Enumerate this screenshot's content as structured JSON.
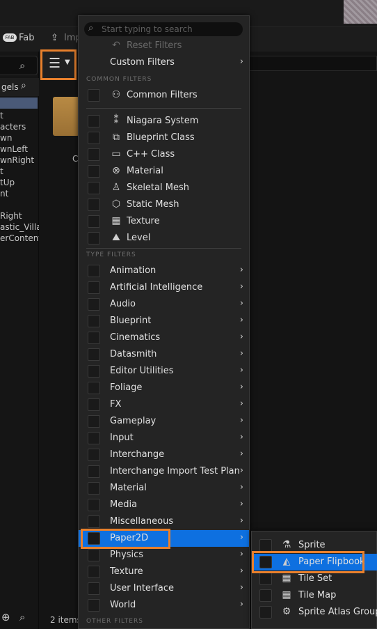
{
  "top_toolbar": {
    "fab_label": "Fab",
    "import_label": "Imp"
  },
  "left_panel": {
    "header_label": "gels",
    "tree_items": [
      "t",
      "acters",
      "wn",
      "wnLeft",
      "wnRight",
      "t",
      "tUp",
      "nt",
      "",
      "Right",
      "astic_Villa",
      "erContent"
    ]
  },
  "content": {
    "folder_caption": "C",
    "items_count": "2 items"
  },
  "filter_menu": {
    "search_placeholder": "Start typing to search",
    "reset_filters": "Reset Filters",
    "custom_filters": "Custom Filters",
    "common_filters_section": "COMMON FILTERS",
    "common_filters_item": "Common Filters",
    "common_items": [
      {
        "label": "Niagara System",
        "icon": "niagara-icon"
      },
      {
        "label": "Blueprint Class",
        "icon": "blueprint-class-icon"
      },
      {
        "label": "C++ Class",
        "icon": "cpp-class-icon"
      },
      {
        "label": "Material",
        "icon": "material-icon"
      },
      {
        "label": "Skeletal Mesh",
        "icon": "skeletal-mesh-icon"
      },
      {
        "label": "Static Mesh",
        "icon": "static-mesh-icon"
      },
      {
        "label": "Texture",
        "icon": "texture-icon"
      },
      {
        "label": "Level",
        "icon": "level-icon"
      }
    ],
    "type_filters_section": "TYPE FILTERS",
    "type_items": [
      "Animation",
      "Artificial Intelligence",
      "Audio",
      "Blueprint",
      "Cinematics",
      "Datasmith",
      "Editor Utilities",
      "Foliage",
      "FX",
      "Gameplay",
      "Input",
      "Interchange",
      "Interchange Import Test Plan",
      "Material",
      "Media",
      "Miscellaneous",
      "Paper2D",
      "Physics",
      "Texture",
      "User Interface",
      "World"
    ],
    "selected_type": "Paper2D",
    "other_filters_section": "OTHER FILTERS"
  },
  "paper2d_submenu": {
    "items": [
      {
        "label": "Sprite",
        "icon": "sprite-icon"
      },
      {
        "label": "Paper Flipbook",
        "icon": "flipbook-icon"
      },
      {
        "label": "Tile Set",
        "icon": "tile-set-icon"
      },
      {
        "label": "Tile Map",
        "icon": "tile-map-icon"
      },
      {
        "label": "Sprite Atlas Group",
        "icon": "sprite-atlas-icon"
      }
    ],
    "selected_item": "Paper Flipbook"
  },
  "colors": {
    "highlight": "#e8802c",
    "selection": "#0e70e0",
    "menu_bg": "#242424"
  }
}
